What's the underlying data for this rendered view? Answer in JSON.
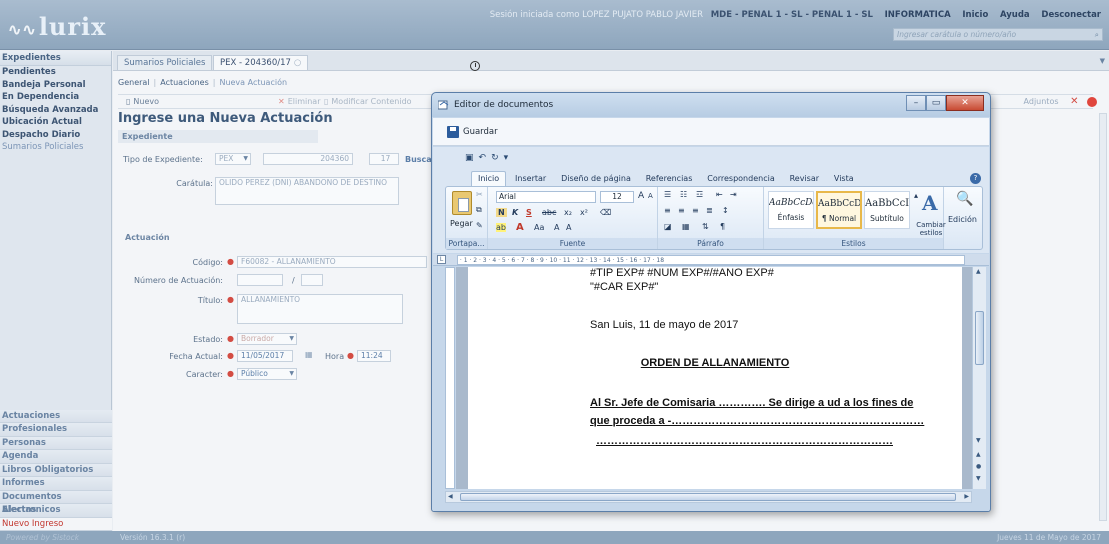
{
  "header": {
    "logo": "lurix",
    "session_text": "Sesión iniciada como LOPEZ PUJATO PABLO JAVIER",
    "office": "MDE - PENAL 1 - SL - PENAL 1 - SL",
    "nav": [
      "INFORMATICA",
      "Inicio",
      "Ayuda",
      "Desconectar"
    ],
    "search_placeholder": "Ingresar carátula o número/año"
  },
  "sidebar": {
    "head": "Expedientes",
    "items": [
      "Pendientes",
      "Bandeja Personal",
      "En Dependencia",
      "Búsqueda Avanzada",
      "Ubicación Actual",
      "Despacho Diario"
    ],
    "link": "Sumarios Policiales",
    "sections": [
      "Actuaciones",
      "Profesionales",
      "Personas",
      "Agenda",
      "Libros Obligatorios",
      "Informes",
      "Documentos Electronicos",
      "Alertas"
    ],
    "alert_item": "Nuevo Ingreso"
  },
  "main": {
    "tabs": [
      "Sumarios Policiales",
      "PEX - 204360/17"
    ],
    "subnav": [
      "General",
      "Actuaciones",
      "Nueva Actuación"
    ],
    "toolbar": {
      "new": "Nuevo",
      "delete": "Eliminar",
      "modify": "Modificar Contenido",
      "attachments": "Adjuntos"
    },
    "title": "Ingrese una Nueva Actuación",
    "panel": "Expediente",
    "tipo_label": "Tipo de Expediente:",
    "tipo_value": "PEX",
    "numero": "204360",
    "anio": "17",
    "buscar": "Busca",
    "caratula_label": "Carátula:",
    "caratula_value": "OLIDO PEREZ (DNI) ABANDONO DE DESTINO",
    "actuacion_label": "Actuación",
    "codigo_label": "Código:",
    "codigo_value": "F60082 - ALLANAMIENTO",
    "numero_act_label": "Número de Actuación:",
    "titulo_label": "Título:",
    "titulo_value": "ALLANAMIENTO",
    "estado_label": "Estado:",
    "estado_value": "Borrador",
    "fecha_label": "Fecha Actual:",
    "fecha_value": "11/05/2017",
    "hora_label": "Hora",
    "hora_value": "11:24",
    "caracter_label": "Caracter:",
    "caracter_value": "Público"
  },
  "footer": {
    "left": "Powered by Sistock",
    "version": "Versión 16.3.1 (r)",
    "date": "Jueves 11 de Mayo de 2017"
  },
  "editor": {
    "title": "Editor de documentos",
    "save": "Guardar",
    "tabs": [
      "Inicio",
      "Insertar",
      "Diseño de página",
      "Referencias",
      "Correspondencia",
      "Revisar",
      "Vista"
    ],
    "font": "Arial",
    "size": "12",
    "groups": [
      "Portapa...",
      "Fuente",
      "Párrafo",
      "Estilos"
    ],
    "paste": "Pegar",
    "styles": [
      {
        "sample": "AaBbCcDdI",
        "name": "Énfasis"
      },
      {
        "sample": "AaBbCcDc",
        "name": "¶ Normal"
      },
      {
        "sample": "AaBbCcI",
        "name": "Subtítulo"
      }
    ],
    "change_styles": "Cambiar estilos",
    "edit": "Edición",
    "doc": {
      "line1": "#TIP EXP# #NUM EXP#/#ANO EXP#",
      "line2": "\"#CAR EXP#\"",
      "line3": "San Luis, 11 de mayo de 2017",
      "heading": "ORDEN DE ALLANAMIENTO",
      "line4": "Al Sr. Jefe de  Comisaria   ………….  Se dirige a ud a los fines de",
      "line5": "que proceda a -……………………………………………………………",
      "line6": "………………………………………………………………………"
    }
  }
}
